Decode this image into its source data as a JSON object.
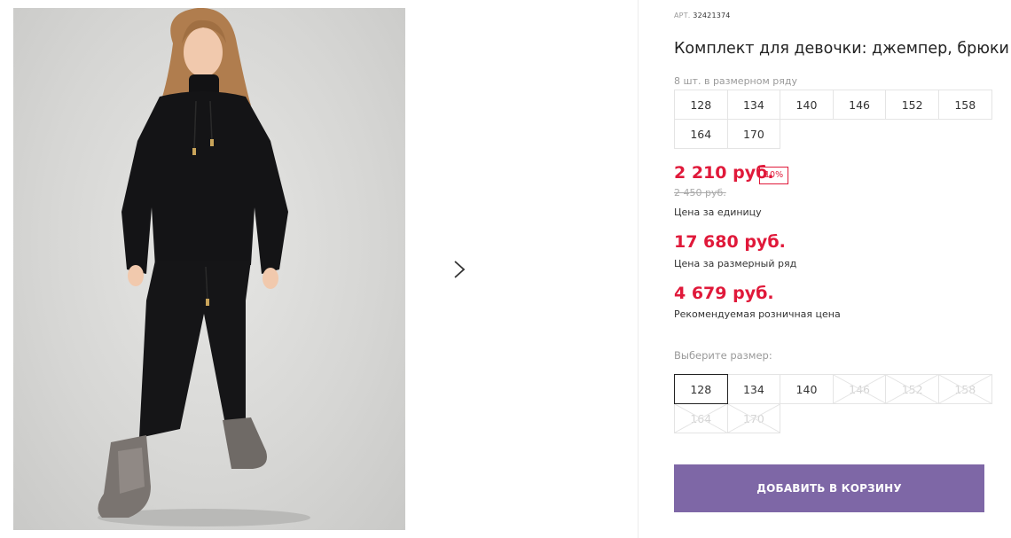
{
  "product": {
    "art_label": "АРТ.",
    "art_number": "32421374",
    "title": "Комплект для девочки: джемпер, брюки",
    "size_row_note": "8 шт. в размерном ряду"
  },
  "size_row": [
    "128",
    "134",
    "140",
    "146",
    "152",
    "158",
    "164",
    "170"
  ],
  "pricing": {
    "unit_price": "2 210 руб.",
    "discount": "10%",
    "old_price": "2 450 руб.",
    "unit_caption": "Цена за единицу",
    "row_price": "17 680 руб.",
    "row_caption": "Цена за размерный ряд",
    "retail_price": "4 679 руб.",
    "retail_caption": "Рекомендуемая розничная цена"
  },
  "size_select": {
    "label": "Выберите размер:",
    "options": [
      {
        "size": "128",
        "selected": true,
        "available": true
      },
      {
        "size": "134",
        "selected": false,
        "available": true
      },
      {
        "size": "140",
        "selected": false,
        "available": true
      },
      {
        "size": "146",
        "selected": false,
        "available": false
      },
      {
        "size": "152",
        "selected": false,
        "available": false
      },
      {
        "size": "158",
        "selected": false,
        "available": false
      },
      {
        "size": "164",
        "selected": false,
        "available": false
      },
      {
        "size": "170",
        "selected": false,
        "available": false
      }
    ]
  },
  "cart_button": "ДОБАВИТЬ В КОРЗИНУ",
  "gallery": {
    "next_icon": "chevron-right-icon"
  },
  "colors": {
    "price_red": "#e0193a",
    "button_purple": "#7e67a6"
  }
}
